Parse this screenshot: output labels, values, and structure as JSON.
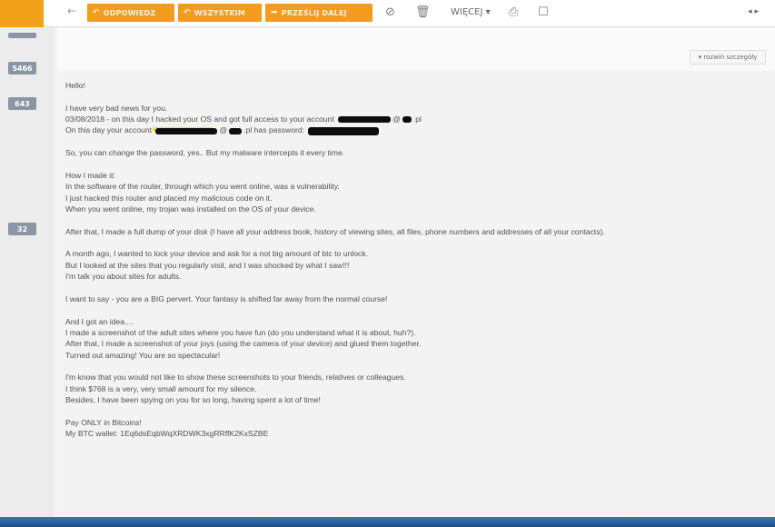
{
  "toolbar": {
    "back": "←",
    "reply_label": "ODPOWIEDZ",
    "reply_all_label": "WSZYSTKIM",
    "forward_label": "PRZEŚLIJ DALEJ",
    "more_label": "WIĘCEJ ▾",
    "nav_arrows": "◂ ▸"
  },
  "sidebar": {
    "badges": [
      "5466",
      "643",
      "32"
    ]
  },
  "message": {
    "reply_menu": "▾ rozwiń szczegóły",
    "greeting": "Hello!",
    "p1": [
      "I have very bad news for you.",
      "03/08/2018 - on this day I",
      "hacked your OS and got full access to your account",
      "@",
      ".pl",
      "On this day your account",
      "@",
      ".pl has password:"
    ],
    "p2": "So, you can change the password, yes.. But my malware intercepts it every time.",
    "p3": [
      "How I made it:",
      "In the software of the router, through which you went online, was a vulnerability.",
      "I just hacked this router and placed my malicious code on it.",
      "When you went online, my trojan was installed on the OS of your device."
    ],
    "p4": "After that, I made a full dump of your disk (I have all your address book, history of viewing sites, all files, phone numbers and addresses of all your contacts).",
    "p5": [
      "A month ago, I wanted to lock your device and ask for a not big amount of btc to unlock.",
      "But I looked at the sites that you regularly visit, and I was shocked by what I saw!!!",
      "I'm talk you about sites for adults."
    ],
    "p6": "I want to say - you are a BIG pervert. Your fantasy is shifted far away from the normal course!",
    "p7": [
      "And I got an idea....",
      "I made a screenshot of the adult sites where you have fun (do you understand what it is about, huh?).",
      "After that, I made a screenshot of your joys (using the camera of your device) and glued them together.",
      "Turned out amazing! You are so spectacular!"
    ],
    "p8": [
      "I'm know that you would not like to show these screenshots to your friends, relatives or colleagues.",
      "I think $768 is a very, very small amount for my silence.",
      "Besides, I have been spying on you for so long, having spent a lot of time!"
    ],
    "p9": [
      "Pay ONLY in Bitcoins!",
      "My BTC wallet: 1Eq6dsEqbWqXRDWK3xgRRffK2KxSZBE"
    ]
  },
  "colors": {
    "accent": "#f39b1b",
    "badge": "#8a96a3",
    "highlight": "#f5e03a"
  }
}
